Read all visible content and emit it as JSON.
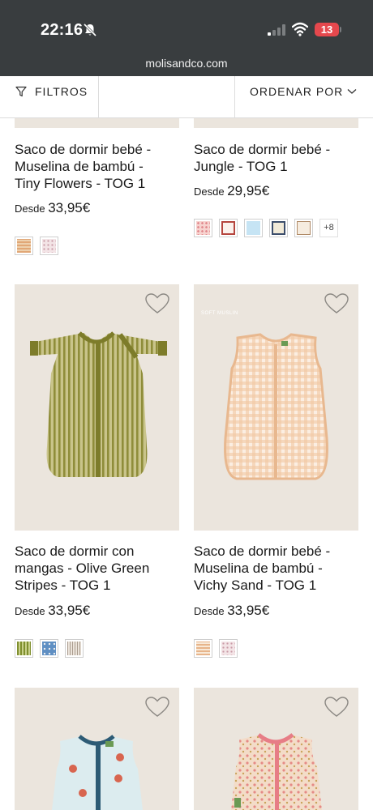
{
  "status_bar": {
    "time": "22:16",
    "battery": "13"
  },
  "browser": {
    "url": "molisandco.com"
  },
  "toolbar": {
    "filters_label": "FILTROS",
    "sort_label": "ORDENAR POR"
  },
  "colors": {
    "status_bar_bg": "#393d3f",
    "product_bg": "#ebe5dd",
    "battery": "#e5484d"
  },
  "products": [
    {
      "name": "Saco de dormir bebé - Muselina de bambú - Tiny Flowers - TOG 1",
      "name_lines": [
        "Saco de dormir bebé -",
        "Muselina de bambú -",
        "Tiny Flowers - TOG 1"
      ],
      "price_prefix": "Desde",
      "price": "33,95€",
      "swatches": [
        "beige-check",
        "pink-dots"
      ]
    },
    {
      "name": "Saco de dormir bebé - Jungle - TOG 1",
      "name_lines": [
        "Saco de dormir bebé -",
        "Jungle - TOG 1"
      ],
      "price_prefix": "Desde",
      "price": "29,95€",
      "swatches": [
        "pink-pattern",
        "red-frame",
        "light-blue",
        "navy-frame",
        "cream-floral"
      ],
      "more_colors": "+8"
    },
    {
      "name": "Saco de dormir con mangas - Olive Green Stripes - TOG 1",
      "name_lines": [
        "Saco de dormir con",
        "mangas - Olive Green",
        "Stripes - TOG 1"
      ],
      "price_prefix": "Desde",
      "price": "33,95€",
      "swatches": [
        "olive-stripes",
        "blue-print",
        "grey-check"
      ]
    },
    {
      "name": "Saco de dormir bebé - Muselina de bambú - Vichy Sand - TOG 1",
      "name_lines": [
        "Saco de dormir bebé -",
        "Muselina de bambú -",
        "Vichy Sand - TOG 1"
      ],
      "price_prefix": "Desde",
      "price": "33,95€",
      "swatches": [
        "sand-check",
        "pink-dots"
      ],
      "badge": "SOFT MUSLIN"
    },
    {
      "name": "",
      "name_lines": [],
      "swatches": []
    },
    {
      "name": "",
      "name_lines": [],
      "swatches": []
    }
  ]
}
